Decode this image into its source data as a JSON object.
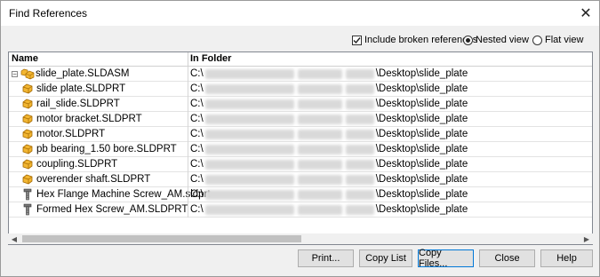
{
  "window": {
    "title": "Find References",
    "close_symbol": "✕"
  },
  "options": {
    "include_broken": {
      "label": "Include broken references",
      "checked": true
    },
    "nested_view": {
      "label": "Nested view",
      "selected": true
    },
    "flat_view": {
      "label": "Flat view",
      "selected": false
    }
  },
  "table": {
    "headers": {
      "name": "Name",
      "folder": "In Folder"
    },
    "rows": [
      {
        "name": "slide_plate.SLDASM",
        "icon": "assembly-icon",
        "expander": "−",
        "folder_prefix": "C:\\",
        "folder_suffix": "\\Desktop\\slide_plate"
      },
      {
        "name": "slide plate.SLDPRT",
        "icon": "part-icon",
        "folder_prefix": "C:\\",
        "folder_suffix": "\\Desktop\\slide_plate"
      },
      {
        "name": "rail_slide.SLDPRT",
        "icon": "part-icon",
        "folder_prefix": "C:\\",
        "folder_suffix": "\\Desktop\\slide_plate"
      },
      {
        "name": "motor bracket.SLDPRT",
        "icon": "part-icon",
        "folder_prefix": "C:\\",
        "folder_suffix": "\\Desktop\\slide_plate"
      },
      {
        "name": "motor.SLDPRT",
        "icon": "part-icon",
        "folder_prefix": "C:\\",
        "folder_suffix": "\\Desktop\\slide_plate"
      },
      {
        "name": "pb bearing_1.50 bore.SLDPRT",
        "icon": "part-icon",
        "folder_prefix": "C:\\",
        "folder_suffix": "\\Desktop\\slide_plate"
      },
      {
        "name": "coupling.SLDPRT",
        "icon": "part-icon",
        "folder_prefix": "C:\\",
        "folder_suffix": "\\Desktop\\slide_plate"
      },
      {
        "name": "overender shaft.SLDPRT",
        "icon": "part-icon",
        "folder_prefix": "C:\\",
        "folder_suffix": "\\Desktop\\slide_plate"
      },
      {
        "name": "Hex Flange Machine Screw_AM.sldprt",
        "icon": "screw-icon",
        "folder_prefix": "C:\\",
        "folder_suffix": "\\Desktop\\slide_plate"
      },
      {
        "name": "Formed Hex Screw_AM.SLDPRT",
        "icon": "screw-icon",
        "folder_prefix": "C:\\",
        "folder_suffix": "\\Desktop\\slide_plate"
      }
    ]
  },
  "scrollbar": {
    "left_arrow": "◀",
    "right_arrow": "▶"
  },
  "buttons": {
    "print": "Print...",
    "copy_list": "Copy List",
    "copy_files": "Copy Files...",
    "close": "Close",
    "help": "Help"
  },
  "colors": {
    "accent": "#0078d7",
    "part_icon": "#e8a317"
  }
}
